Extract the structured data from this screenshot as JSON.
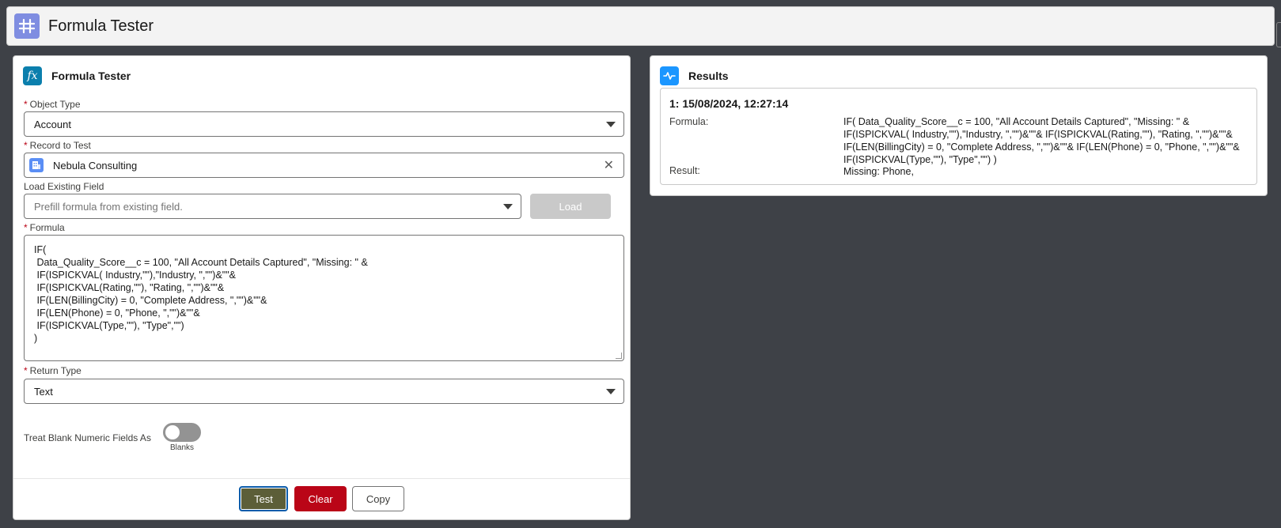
{
  "header": {
    "title": "Formula Tester",
    "icon": "formula-bridge-icon"
  },
  "left_card": {
    "title": "Formula Tester",
    "icon": "fx-icon",
    "object_type": {
      "label": "Object Type",
      "value": "Account"
    },
    "record": {
      "label": "Record to Test",
      "value": "Nebula Consulting"
    },
    "existing_field": {
      "label": "Load Existing Field",
      "placeholder": "Prefill formula from existing field.",
      "load_label": "Load"
    },
    "formula": {
      "label": "Formula",
      "value": "IF(\n Data_Quality_Score__c = 100, \"All Account Details Captured\", \"Missing: \" &\n IF(ISPICKVAL( Industry,\"\"),\"Industry, \",\"\")&\"\"&\n IF(ISPICKVAL(Rating,\"\"), \"Rating, \",\"\")&\"\"&\n IF(LEN(BillingCity) = 0, \"Complete Address, \",\"\")&\"\"&\n IF(LEN(Phone) = 0, \"Phone, \",\"\")&\"\"&\n IF(ISPICKVAL(Type,\"\"), \"Type\",\"\")\n)"
    },
    "return_type": {
      "label": "Return Type",
      "value": "Text"
    },
    "blank_toggle": {
      "label": "Treat Blank Numeric Fields As",
      "state_label": "Blanks",
      "on": false
    },
    "buttons": {
      "test": "Test",
      "clear": "Clear",
      "copy": "Copy"
    }
  },
  "results": {
    "title": "Results",
    "icon": "pulse-icon",
    "entries": [
      {
        "heading": "1: 15/08/2024, 12:27:14",
        "formula_label": "Formula:",
        "formula_value": "IF( Data_Quality_Score__c = 100, \"All Account Details Captured\", \"Missing: \" & IF(ISPICKVAL( Industry,\"\"),\"Industry, \",\"\")&\"\"& IF(ISPICKVAL(Rating,\"\"), \"Rating, \",\"\")&\"\"& IF(LEN(BillingCity) = 0, \"Complete Address, \",\"\")&\"\"& IF(LEN(Phone) = 0, \"Phone, \",\"\")&\"\"& IF(ISPICKVAL(Type,\"\"), \"Type\",\"\") )",
        "result_label": "Result:",
        "result_value": "Missing: Phone,"
      }
    ]
  }
}
